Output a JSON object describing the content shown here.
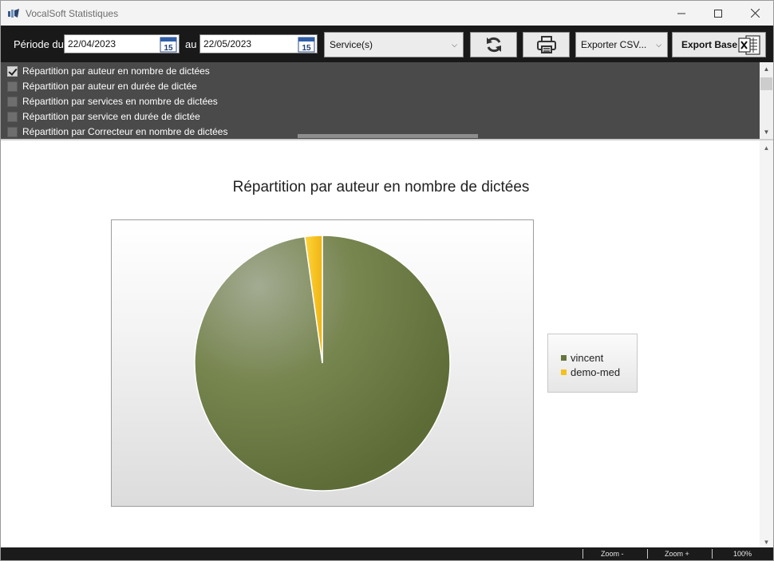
{
  "window": {
    "title": "VocalSoft Statistiques"
  },
  "toolbar": {
    "period_label": "Période du",
    "date_from": "22/04/2023",
    "to_label": "au",
    "date_to": "22/05/2023",
    "service_select": "Service(s)",
    "refresh_icon": "refresh-icon",
    "print_icon": "printer-icon",
    "export_csv_select": "Exporter CSV...",
    "export_base_label": "Export Base",
    "excel_icon": "excel-icon",
    "calendar_day": "15"
  },
  "checklist": {
    "items": [
      {
        "label": "Répartition par auteur en nombre de dictées",
        "checked": true
      },
      {
        "label": "Répartition par auteur en durée de dictée",
        "checked": false
      },
      {
        "label": "Répartition par services en nombre de dictées",
        "checked": false
      },
      {
        "label": "Répartition par service en durée de dictée",
        "checked": false
      },
      {
        "label": "Répartition par Correcteur en nombre de dictées",
        "checked": false
      }
    ]
  },
  "chart_data": {
    "type": "pie",
    "title": "Répartition par auteur en nombre de dictées",
    "categories": [
      "vincent",
      "demo-med"
    ],
    "values": [
      97.8,
      2.2
    ],
    "colors": [
      "#66753f",
      "#f5c11c"
    ],
    "legend": "right"
  },
  "statusbar": {
    "zoom_minus": "Zoom -",
    "zoom_plus": "Zoom +",
    "zoom_level": "100%"
  }
}
